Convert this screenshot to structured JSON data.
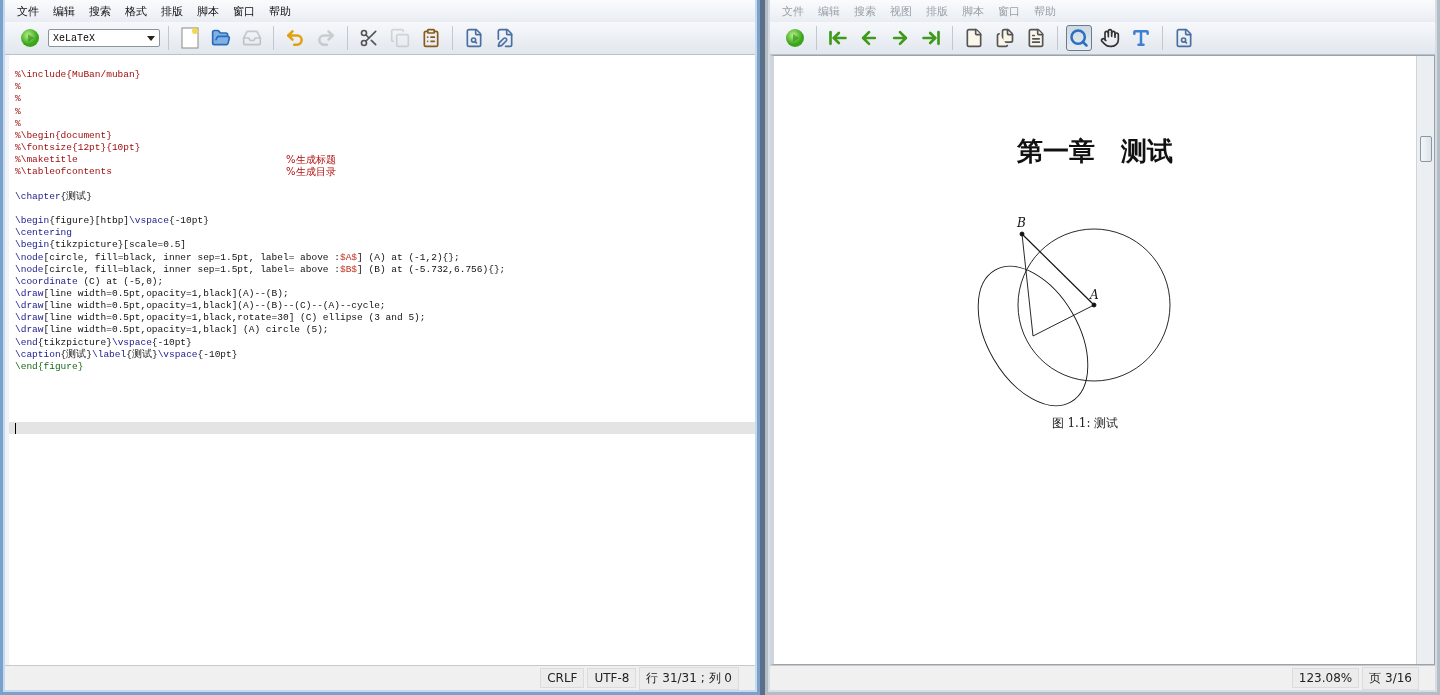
{
  "editor_window": {
    "active": true,
    "menu": [
      "文件",
      "编辑",
      "搜索",
      "格式",
      "排版",
      "脚本",
      "窗口",
      "帮助"
    ],
    "toolbar": [
      {
        "kind": "run",
        "disabled": false
      },
      {
        "kind": "compiler",
        "value": "XeLaTeX"
      },
      {
        "kind": "separator"
      },
      {
        "kind": "new",
        "disabled": false
      },
      {
        "kind": "open",
        "disabled": false
      },
      {
        "kind": "save",
        "disabled": true
      },
      {
        "kind": "separator"
      },
      {
        "kind": "undo",
        "disabled": false
      },
      {
        "kind": "redo",
        "disabled": true
      },
      {
        "kind": "separator"
      },
      {
        "kind": "cut",
        "disabled": false
      },
      {
        "kind": "copy",
        "disabled": true
      },
      {
        "kind": "paste",
        "disabled": false
      },
      {
        "kind": "separator"
      },
      {
        "kind": "preview",
        "disabled": false
      },
      {
        "kind": "edit",
        "disabled": false
      }
    ],
    "lines": [
      {
        "kind": "blank",
        "current": false
      },
      {
        "kind": "code",
        "current": false,
        "segments": [
          {
            "kind": "comment",
            "text": "%\\include{MuBan/muban}"
          }
        ]
      },
      {
        "kind": "code",
        "current": false,
        "segments": [
          {
            "kind": "comment",
            "text": "%"
          }
        ]
      },
      {
        "kind": "code",
        "current": false,
        "segments": [
          {
            "kind": "comment",
            "text": "%"
          }
        ]
      },
      {
        "kind": "code",
        "current": false,
        "segments": [
          {
            "kind": "comment",
            "text": "%"
          }
        ]
      },
      {
        "kind": "code",
        "current": false,
        "segments": [
          {
            "kind": "comment",
            "text": "%"
          }
        ]
      },
      {
        "kind": "code",
        "current": false,
        "segments": [
          {
            "kind": "comment",
            "text": "%\\begin{document}"
          }
        ]
      },
      {
        "kind": "code",
        "current": false,
        "segments": [
          {
            "kind": "comment",
            "text": "%\\fontsize{12pt}{10pt}"
          }
        ]
      },
      {
        "kind": "code",
        "current": false,
        "segments": [
          {
            "kind": "comment",
            "text": "%\\maketitle"
          }
        ],
        "trail": "%生成标题"
      },
      {
        "kind": "code",
        "current": false,
        "segments": [
          {
            "kind": "comment",
            "text": "%\\tableofcontents"
          }
        ],
        "trail": "%生成目录"
      },
      {
        "kind": "blank",
        "current": false
      },
      {
        "kind": "code",
        "current": false,
        "segments": [
          {
            "kind": "command",
            "text": "\\chapter"
          },
          {
            "kind": "plain",
            "text": "{测试}"
          }
        ]
      },
      {
        "kind": "blank",
        "current": false
      },
      {
        "kind": "code",
        "current": false,
        "segments": [
          {
            "kind": "command",
            "text": "\\begin"
          },
          {
            "kind": "plain",
            "text": "{figure}[htbp]"
          },
          {
            "kind": "command",
            "text": "\\vspace"
          },
          {
            "kind": "plain",
            "text": "{-10pt}"
          }
        ]
      },
      {
        "kind": "code",
        "current": false,
        "segments": [
          {
            "kind": "command",
            "text": "\\centering"
          }
        ]
      },
      {
        "kind": "code",
        "current": false,
        "segments": [
          {
            "kind": "command",
            "text": "\\begin"
          },
          {
            "kind": "plain",
            "text": "{tikzpicture}[scale=0.5]"
          }
        ]
      },
      {
        "kind": "code",
        "current": false,
        "segments": [
          {
            "kind": "command",
            "text": "\\node"
          },
          {
            "kind": "plain",
            "text": "[circle, fill=black, inner sep=1.5pt, label= above :"
          },
          {
            "kind": "math",
            "text": "$A$"
          },
          {
            "kind": "plain",
            "text": "] (A) at (-1,2){};"
          }
        ]
      },
      {
        "kind": "code",
        "current": false,
        "segments": [
          {
            "kind": "command",
            "text": "\\node"
          },
          {
            "kind": "plain",
            "text": "[circle, fill=black, inner sep=1.5pt, label= above :"
          },
          {
            "kind": "math",
            "text": "$B$"
          },
          {
            "kind": "plain",
            "text": "] (B) at (-5.732,6.756){};"
          }
        ]
      },
      {
        "kind": "code",
        "current": false,
        "segments": [
          {
            "kind": "command",
            "text": "\\coordinate"
          },
          {
            "kind": "plain",
            "text": " (C) at (-5,0);"
          }
        ]
      },
      {
        "kind": "code",
        "current": false,
        "segments": [
          {
            "kind": "command",
            "text": "\\draw"
          },
          {
            "kind": "plain",
            "text": "[line width=0.5pt,opacity=1,black](A)--(B);"
          }
        ]
      },
      {
        "kind": "code",
        "current": false,
        "segments": [
          {
            "kind": "command",
            "text": "\\draw"
          },
          {
            "kind": "plain",
            "text": "[line width=0.5pt,opacity=1,black](A)--(B)--(C)--(A)--cycle;"
          }
        ]
      },
      {
        "kind": "code",
        "current": false,
        "segments": [
          {
            "kind": "command",
            "text": "\\draw"
          },
          {
            "kind": "plain",
            "text": "[line width=0.5pt,opacity=1,black,rotate=30] (C) ellipse (3 and 5);"
          }
        ]
      },
      {
        "kind": "code",
        "current": false,
        "segments": [
          {
            "kind": "command",
            "text": "\\draw"
          },
          {
            "kind": "plain",
            "text": "[line width=0.5pt,opacity=1,black] (A) circle (5);"
          }
        ]
      },
      {
        "kind": "code",
        "current": false,
        "segments": [
          {
            "kind": "command",
            "text": "\\end"
          },
          {
            "kind": "plain",
            "text": "{tikzpicture}"
          },
          {
            "kind": "command",
            "text": "\\vspace"
          },
          {
            "kind": "plain",
            "text": "{-10pt}"
          }
        ]
      },
      {
        "kind": "code",
        "current": false,
        "segments": [
          {
            "kind": "command",
            "text": "\\caption"
          },
          {
            "kind": "plain",
            "text": "{测试}"
          },
          {
            "kind": "command",
            "text": "\\label"
          },
          {
            "kind": "plain",
            "text": "{测试}"
          },
          {
            "kind": "command",
            "text": "\\vspace"
          },
          {
            "kind": "plain",
            "text": "{-10pt}"
          }
        ]
      },
      {
        "kind": "code",
        "current": false,
        "segments": [
          {
            "kind": "env",
            "text": "\\end{figure}"
          }
        ]
      },
      {
        "kind": "blank",
        "current": false
      },
      {
        "kind": "blank",
        "current": false
      },
      {
        "kind": "blank",
        "current": false
      },
      {
        "kind": "blank",
        "current": false
      },
      {
        "kind": "blank",
        "current": true
      }
    ],
    "status_bar": [
      "CRLF",
      "UTF-8",
      "行 31/31 ; 列 0"
    ]
  },
  "viewer_window": {
    "active": false,
    "menu": [
      "文件",
      "编辑",
      "搜索",
      "视图",
      "排版",
      "脚本",
      "窗口",
      "帮助"
    ],
    "toolbar": [
      {
        "kind": "run",
        "selected": false
      },
      {
        "kind": "separator"
      },
      {
        "kind": "first",
        "selected": false
      },
      {
        "kind": "prev",
        "selected": false
      },
      {
        "kind": "next",
        "selected": false
      },
      {
        "kind": "last",
        "selected": false
      },
      {
        "kind": "separator"
      },
      {
        "kind": "page-single",
        "selected": false
      },
      {
        "kind": "page-double",
        "selected": false
      },
      {
        "kind": "page-fit",
        "selected": false
      },
      {
        "kind": "separator"
      },
      {
        "kind": "zoom",
        "selected": true
      },
      {
        "kind": "hand",
        "selected": false
      },
      {
        "kind": "text-select",
        "selected": false
      },
      {
        "kind": "separator"
      },
      {
        "kind": "find",
        "selected": false
      }
    ],
    "page": {
      "heading": "第一章　测试",
      "figure": {
        "labels": [
          "B",
          "A"
        ]
      },
      "caption": "图 1.1: 测试"
    },
    "status_bar": [
      "123.08%",
      "页 3/16"
    ]
  }
}
